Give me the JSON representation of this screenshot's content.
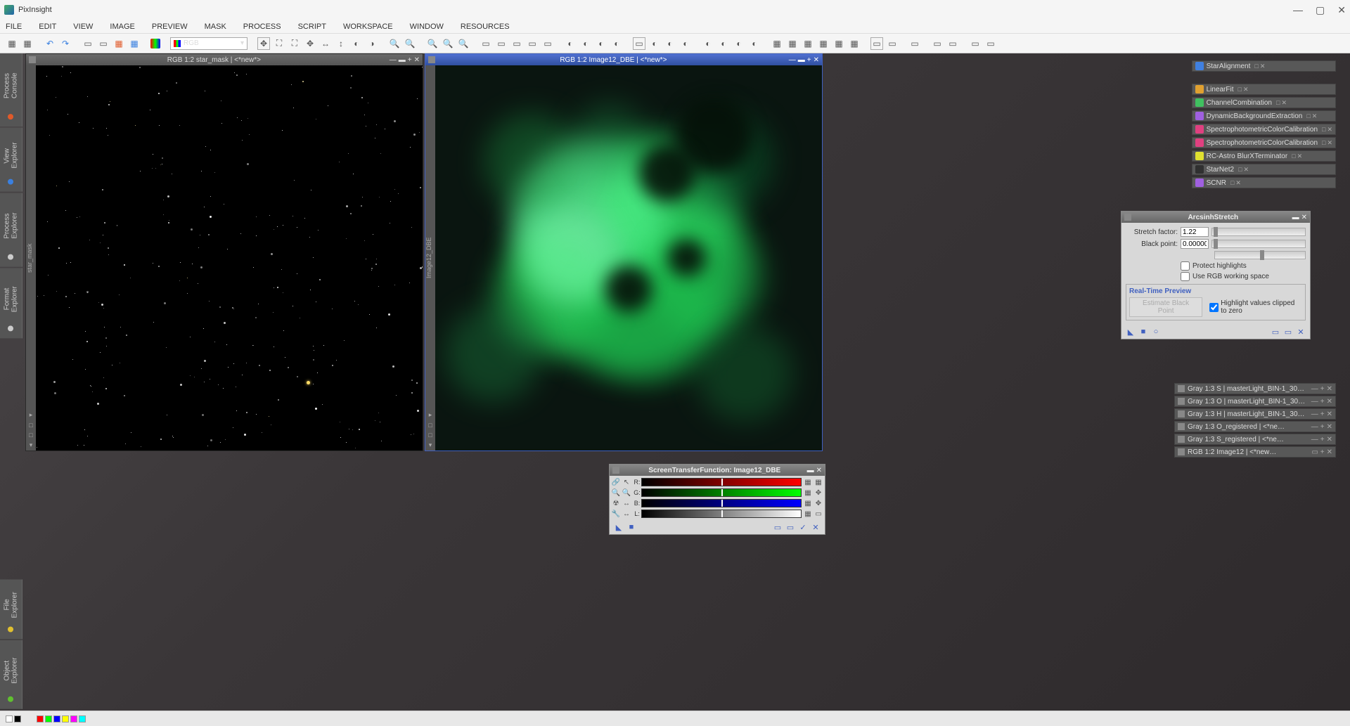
{
  "app": {
    "title": "PixInsight"
  },
  "menus": [
    "FILE",
    "EDIT",
    "VIEW",
    "IMAGE",
    "PREVIEW",
    "MASK",
    "PROCESS",
    "SCRIPT",
    "WORKSPACE",
    "WINDOW",
    "RESOURCES"
  ],
  "toolbar": {
    "channel_select": "RGB"
  },
  "left_tabs": [
    {
      "label": "Process Console",
      "color": "#e05a2a"
    },
    {
      "label": "View Explorer",
      "color": "#3a80e0"
    },
    {
      "label": "Process Explorer",
      "color": "#cccccc"
    },
    {
      "label": "Format Explorer",
      "color": "#cccccc"
    },
    {
      "label": "File Explorer",
      "color": "#e0c030"
    },
    {
      "label": "Object Explorer",
      "color": "#60c030"
    }
  ],
  "windows": {
    "left": {
      "title": "RGB 1:2 star_mask | <*new*>",
      "sidebar": "star_mask"
    },
    "right": {
      "title": "RGB 1:2 Image12_DBE | <*new*>",
      "sidebar": "Image12_DBE"
    }
  },
  "process_icons": [
    {
      "label": "StarAlignment",
      "color": "#4080e0"
    },
    {
      "label": "LinearFit",
      "color": "#e0a030"
    },
    {
      "label": "ChannelCombination",
      "color": "#40c060"
    },
    {
      "label": "DynamicBackgroundExtraction",
      "color": "#a060e0"
    },
    {
      "label": "SpectrophotometricColorCalibration",
      "color": "#e04080"
    },
    {
      "label": "SpectrophotometricColorCalibration",
      "color": "#e04080"
    },
    {
      "label": "RC-Astro BlurXTerminator",
      "color": "#e0e030"
    },
    {
      "label": "StarNet2",
      "color": "#303030"
    },
    {
      "label": "SCNR",
      "color": "#a060e0"
    }
  ],
  "mini_windows": [
    "Gray 1:3 S | masterLight_BIN-1_30…",
    "Gray 1:3 O | masterLight_BIN-1_30…",
    "Gray 1:3 H | masterLight_BIN-1_30…",
    "Gray 1:3 O_registered | <*ne…",
    "Gray 1:3 S_registered | <*ne…",
    "RGB 1:2 Image12 | <*new…"
  ],
  "arcsinh": {
    "title": "ArcsinhStretch",
    "stretch_label": "Stretch factor:",
    "stretch_value": "1.22",
    "black_label": "Black point:",
    "black_value": "0.000000",
    "protect_label": "Protect highlights",
    "rgb_label": "Use RGB working space",
    "preview_legend": "Real-Time Preview",
    "estimate_btn": "Estimate Black Point",
    "highlight_label": "Highlight values clipped to zero"
  },
  "stf": {
    "title": "ScreenTransferFunction: Image12_DBE",
    "channels": [
      "R:",
      "G:",
      "B:",
      "L:"
    ]
  }
}
